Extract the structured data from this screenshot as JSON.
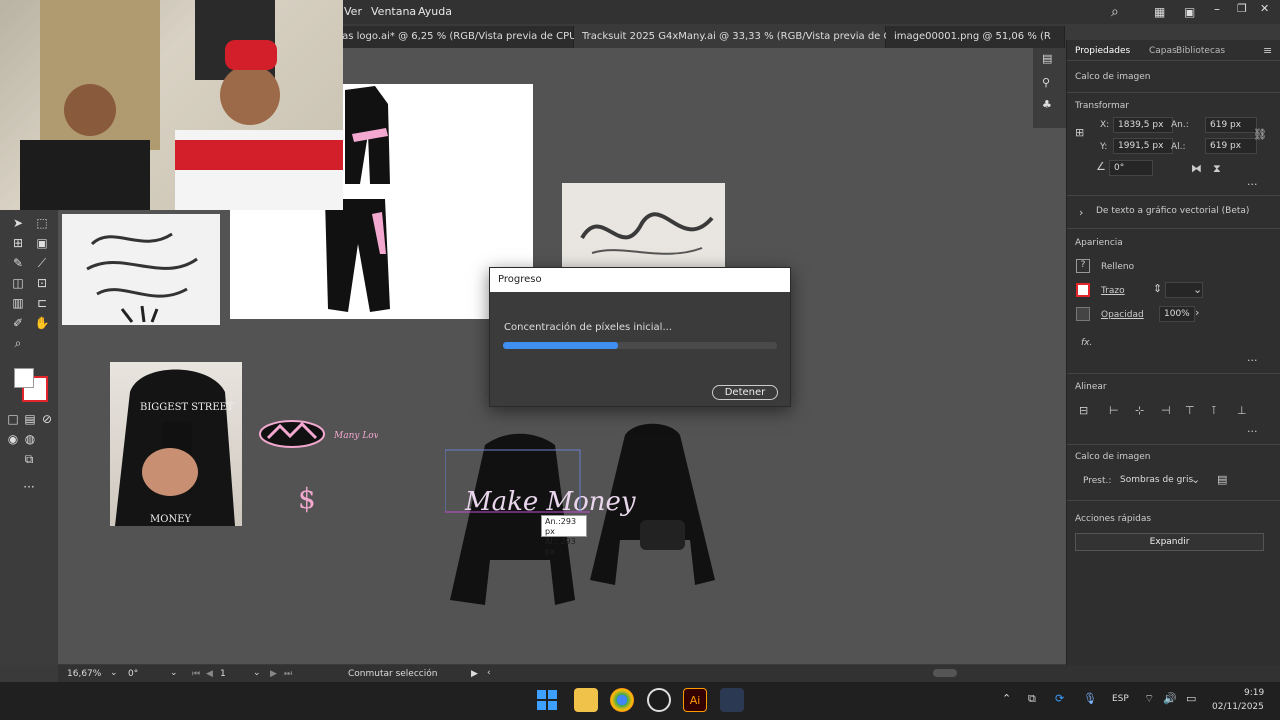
{
  "menubar": {
    "items": [
      "Ver",
      "Ventana",
      "Ayuda"
    ]
  },
  "tabs": [
    {
      "label": "ras logo.ai* @ 6,25 % (RGB/Vista previa de CPU)"
    },
    {
      "label": "Tracksuit 2025 G4xMany.ai @ 33,33 % (RGB/Vista previa de CPU)"
    },
    {
      "label": "image00001.png @ 51,06 % (R"
    }
  ],
  "close_glyph": "✕",
  "dialog": {
    "title": "Progreso",
    "message": "Concentración de píxeles inicial...",
    "progress": 0.42,
    "stop_label": "Detener"
  },
  "tooltip": {
    "width": "An.:293 px",
    "height": "Al.: 293 px"
  },
  "panel": {
    "tabs": [
      "Propiedades",
      "Capas",
      "Bibliotecas"
    ],
    "section_calco": "Calco de imagen",
    "transform_heading": "Transformar",
    "x_label": "X:",
    "x_value": "1839,5 px",
    "y_label": "Y:",
    "y_value": "1991,5 px",
    "w_label": "An.:",
    "w_value": "619 px",
    "h_label": "Al.:",
    "h_value": "619 px",
    "angle_value": "0°",
    "text_to_vector": "De texto a gráfico vectorial (Beta)",
    "appearance_heading": "Apariencia",
    "fill_label": "Relleno",
    "stroke_label": "Trazo",
    "opacity_label": "Opacidad",
    "opacity_value": "100%",
    "fx_label": "fx.",
    "align_heading": "Alinear",
    "calco_heading": "Calco de imagen",
    "preset_label": "Prest.:",
    "preset_value": "Sombras de gris",
    "quick_actions_heading": "Acciones rápidas",
    "expand_label": "Expandir"
  },
  "status": {
    "zoom": "16,67%",
    "rotation": "0°",
    "artboard": "1",
    "tool": "Conmutar selección"
  },
  "taskbar": {
    "lang": "ESP",
    "time": "9:19",
    "date": "02/11/2025"
  },
  "artwork": {
    "hoodie_text": "Make Money",
    "sign_text": "Many Lover Maker",
    "photo_text": "MONEY",
    "hood_text": "BIGGEST STREET"
  },
  "colors": {
    "accent_blue": "#3f8ff0",
    "pink": "#f3a8d0",
    "stroke_red": "#e0262a"
  }
}
